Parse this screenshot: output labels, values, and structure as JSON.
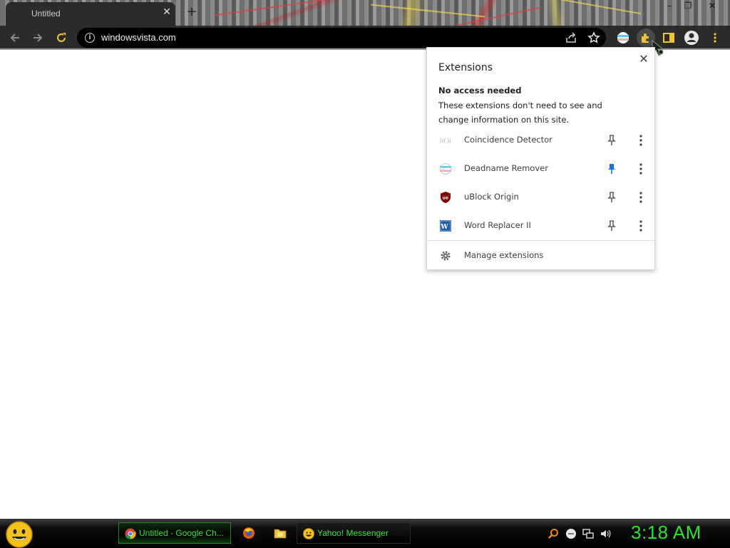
{
  "browser": {
    "tab": {
      "title": "Untitled",
      "close_glyph": "✕"
    },
    "new_tab_glyph": "+",
    "window_controls": {
      "minimize": "–",
      "maximize": "❐",
      "close": "✕"
    },
    "address": {
      "url": "windowsvista.com",
      "info_glyph": "i"
    },
    "toolbar_icons": [
      "back-icon",
      "forward-icon",
      "reload-icon",
      "share-icon",
      "bookmark-star-icon",
      "extension-flag-icon",
      "extensions-puzzle-icon",
      "side-panel-icon",
      "profile-icon",
      "menu-icon"
    ]
  },
  "extensions_popup": {
    "title": "Extensions",
    "close_glyph": "✕",
    "section_heading": "No access needed",
    "section_description": "These extensions don't need to see and change information on this site.",
    "items": [
      {
        "name": "Coincidence Detector",
        "icon": "echo-parentheses-icon",
        "pinned": false
      },
      {
        "name": "Deadname Remover",
        "icon": "trans-flag-icon",
        "pinned": true
      },
      {
        "name": "uBlock Origin",
        "icon": "ublock-shield-icon",
        "pinned": false
      },
      {
        "name": "Word Replacer II",
        "icon": "word-replacer-icon",
        "pinned": false
      }
    ],
    "manage_label": "Manage extensions",
    "colors": {
      "pinned": "#1a73e8",
      "unpinned": "#5f6368"
    }
  },
  "taskbar": {
    "buttons": [
      {
        "label": "Untitled - Google Ch...",
        "icon": "chrome-icon"
      },
      {
        "label": "Yahoo! Messenger",
        "icon": "yahoo-messenger-icon"
      }
    ],
    "quick_launch": [
      "firefox-icon",
      "folder-icon"
    ],
    "tray": [
      "search-tray-icon",
      "messenger-tray-icon",
      "network-icon",
      "volume-icon"
    ],
    "clock": "3:18 AM",
    "colors": {
      "text": "#37e137",
      "clock": "#26e426"
    }
  }
}
